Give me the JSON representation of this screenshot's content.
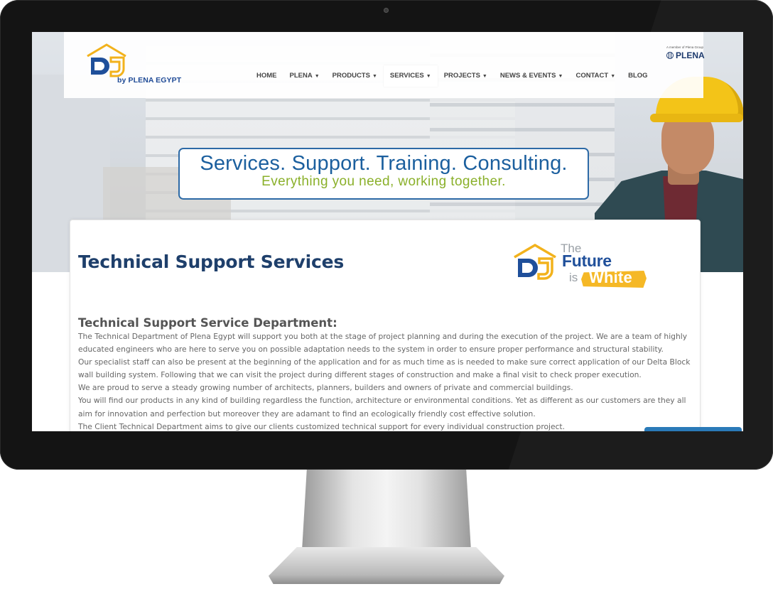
{
  "header": {
    "logo_text": "by PLENA EGYPT",
    "nav": [
      {
        "label": "HOME",
        "caret": false,
        "active": false
      },
      {
        "label": "PLENA",
        "caret": true,
        "active": false
      },
      {
        "label": "PRODUCTS",
        "caret": true,
        "active": false
      },
      {
        "label": "SERVICES",
        "caret": true,
        "active": true
      },
      {
        "label": "PROJECTS",
        "caret": true,
        "active": false
      },
      {
        "label": "NEWS & EVENTS",
        "caret": true,
        "active": false
      },
      {
        "label": "CONTACT",
        "caret": true,
        "active": false
      },
      {
        "label": "BLOG",
        "caret": false,
        "active": false
      }
    ],
    "plena_small": "A member of Plena Group",
    "plena_word": "PLENA"
  },
  "banner": {
    "title": "Services. Support. Training. Consulting.",
    "subtitle": "Everything you need, working together."
  },
  "content": {
    "page_title": "Technical Support Services",
    "future_logo": {
      "the": "The",
      "future": "Future",
      "is": "is",
      "white": "White"
    },
    "section_heading": "Technical Support Service Department:",
    "paragraphs": [
      "The Technical Department of Plena Egypt will support you both at the stage of project planning and during the execution of the project. We are a team of highly educated engineers who are here to serve you on possible adaptation needs to the system in order to ensure proper performance and structural stability.",
      "Our specialist staff can also be present at the beginning of the application and for as much time as is needed to make sure correct application of our Delta Block wall building system. Following that we can visit the project during different stages of construction and make a final visit to check proper execution.",
      "We are proud to serve a steady growing number of architects, planners, builders and owners of private and commercial buildings.",
      "You will find our products in any kind of building regardless the function, architecture or environmental conditions. Yet as different as our customers are they all aim for innovation and perfection but moreover they are adamant to find an ecologically friendly cost effective solution.",
      "The Client Technical Department aims to give our clients customized technical support for every individual construction project."
    ]
  },
  "colors": {
    "brand_blue": "#1e3f6b",
    "banner_blue": "#1b5f9e",
    "banner_green": "#8ab02a",
    "accent_yellow": "#f5b826"
  }
}
